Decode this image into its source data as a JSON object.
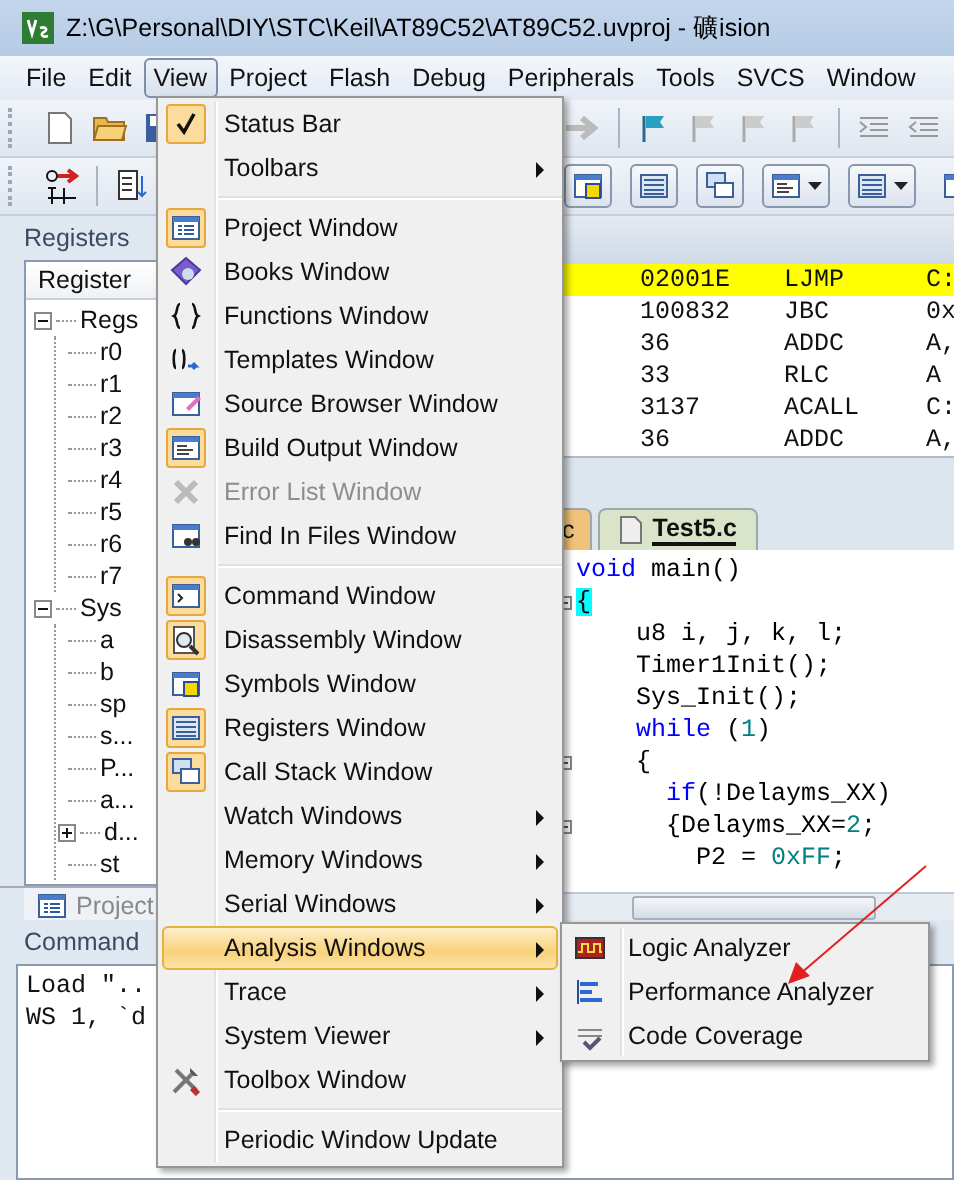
{
  "window": {
    "title": "Z:\\G\\Personal\\DIY\\STC\\Keil\\AT89C52\\AT89C52.uvproj - 礦ision"
  },
  "menu_bar": [
    {
      "label": "File",
      "selected": false
    },
    {
      "label": "Edit",
      "selected": false
    },
    {
      "label": "View",
      "selected": true
    },
    {
      "label": "Project",
      "selected": false
    },
    {
      "label": "Flash",
      "selected": false
    },
    {
      "label": "Debug",
      "selected": false
    },
    {
      "label": "Peripherals",
      "selected": false
    },
    {
      "label": "Tools",
      "selected": false
    },
    {
      "label": "SVCS",
      "selected": false
    },
    {
      "label": "Window",
      "selected": false
    }
  ],
  "registers_panel": {
    "title": "Registers",
    "column": "Register",
    "tab": "Project",
    "tree": [
      {
        "label": "Regs",
        "kind": "group",
        "expanded": true,
        "children": [
          {
            "label": "r0",
            "kind": "leaf"
          },
          {
            "label": "r1",
            "kind": "leaf"
          },
          {
            "label": "r2",
            "kind": "leaf"
          },
          {
            "label": "r3",
            "kind": "leaf"
          },
          {
            "label": "r4",
            "kind": "leaf"
          },
          {
            "label": "r5",
            "kind": "leaf"
          },
          {
            "label": "r6",
            "kind": "leaf"
          },
          {
            "label": "r7",
            "kind": "leaf"
          }
        ]
      },
      {
        "label": "Sys",
        "kind": "group",
        "expanded": true,
        "children": [
          {
            "label": "a",
            "kind": "leaf"
          },
          {
            "label": "b",
            "kind": "leaf"
          },
          {
            "label": "sp",
            "kind": "leaf"
          },
          {
            "label": "s...",
            "kind": "leaf"
          },
          {
            "label": "P...",
            "kind": "leaf"
          },
          {
            "label": "a...",
            "kind": "leaf"
          },
          {
            "label": "d...",
            "kind": "group",
            "expanded": false
          },
          {
            "label": "st",
            "kind": "leaf"
          }
        ]
      }
    ]
  },
  "disassembly": {
    "rows": [
      {
        "opcode": "02001E",
        "mnemonic": "LJMP",
        "operand": "C:",
        "current": true
      },
      {
        "opcode": "100832",
        "mnemonic": "JBC",
        "operand": "0x",
        "current": false
      },
      {
        "opcode": "36",
        "mnemonic": "ADDC",
        "operand": "A,",
        "current": false
      },
      {
        "opcode": "33",
        "mnemonic": "RLC",
        "operand": "A",
        "current": false
      },
      {
        "opcode": "3137",
        "mnemonic": "ACALL",
        "operand": "C:",
        "current": false
      },
      {
        "opcode": "36",
        "mnemonic": "ADDC",
        "operand": "A,",
        "current": false
      }
    ]
  },
  "editor": {
    "tabs": [
      {
        "label": "c",
        "selected": false
      },
      {
        "label": "Test5.c",
        "selected": true
      }
    ],
    "lines": [
      {
        "fold": false,
        "tokens": [
          {
            "text": "void",
            "kind": "keyword"
          },
          {
            "text": " main()",
            "kind": "plain"
          }
        ]
      },
      {
        "fold": true,
        "tokens": [
          {
            "text": "{",
            "kind": "brace_match"
          }
        ]
      },
      {
        "fold": false,
        "tokens": [
          {
            "text": "    u8 i, j, k, l;",
            "kind": "plain"
          }
        ]
      },
      {
        "fold": false,
        "tokens": [
          {
            "text": "    Timer1Init();",
            "kind": "plain"
          }
        ]
      },
      {
        "fold": false,
        "tokens": [
          {
            "text": "    Sys_Init();",
            "kind": "plain"
          }
        ]
      },
      {
        "fold": false,
        "tokens": [
          {
            "text": "    while",
            "kind": "keyword"
          },
          {
            "text": " (",
            "kind": "plain"
          },
          {
            "text": "1",
            "kind": "number"
          },
          {
            "text": ")",
            "kind": "plain"
          }
        ]
      },
      {
        "fold": true,
        "tokens": [
          {
            "text": "    {",
            "kind": "plain"
          }
        ]
      },
      {
        "fold": false,
        "tokens": [
          {
            "text": "      if",
            "kind": "keyword"
          },
          {
            "text": "(!Delayms_XX)",
            "kind": "plain"
          }
        ]
      },
      {
        "fold": true,
        "tokens": [
          {
            "text": "      {Delayms_XX=",
            "kind": "plain"
          },
          {
            "text": "2",
            "kind": "number"
          },
          {
            "text": ";",
            "kind": "plain"
          }
        ]
      },
      {
        "fold": false,
        "tokens": [
          {
            "text": "        P2 = ",
            "kind": "plain"
          },
          {
            "text": "0xFF",
            "kind": "number"
          },
          {
            "text": ";",
            "kind": "plain"
          }
        ]
      }
    ]
  },
  "command_panel": {
    "title": "Command",
    "lines": [
      "Load \"..",
      "WS 1, `d"
    ]
  },
  "view_menu": {
    "items": [
      {
        "kind": "item",
        "label": "Status Bar",
        "checked": true,
        "disabled": false,
        "selected": false,
        "submenu": false
      },
      {
        "kind": "item",
        "label": "Toolbars",
        "checked": false,
        "disabled": false,
        "selected": false,
        "submenu": true
      },
      {
        "kind": "separator"
      },
      {
        "kind": "item",
        "label": "Project Window",
        "checked": true,
        "disabled": false,
        "selected": false,
        "submenu": false
      },
      {
        "kind": "item",
        "label": "Books Window",
        "checked": false,
        "disabled": false,
        "selected": false,
        "submenu": false
      },
      {
        "kind": "item",
        "label": "Functions Window",
        "checked": false,
        "disabled": false,
        "selected": false,
        "submenu": false
      },
      {
        "kind": "item",
        "label": "Templates Window",
        "checked": false,
        "disabled": false,
        "selected": false,
        "submenu": false
      },
      {
        "kind": "item",
        "label": "Source Browser Window",
        "checked": false,
        "disabled": false,
        "selected": false,
        "submenu": false
      },
      {
        "kind": "item",
        "label": "Build Output Window",
        "checked": true,
        "disabled": false,
        "selected": false,
        "submenu": false
      },
      {
        "kind": "item",
        "label": "Error List Window",
        "checked": false,
        "disabled": true,
        "selected": false,
        "submenu": false
      },
      {
        "kind": "item",
        "label": "Find In Files Window",
        "checked": false,
        "disabled": false,
        "selected": false,
        "submenu": false
      },
      {
        "kind": "separator"
      },
      {
        "kind": "item",
        "label": "Command Window",
        "checked": true,
        "disabled": false,
        "selected": false,
        "submenu": false
      },
      {
        "kind": "item",
        "label": "Disassembly Window",
        "checked": true,
        "disabled": false,
        "selected": false,
        "submenu": false
      },
      {
        "kind": "item",
        "label": "Symbols Window",
        "checked": false,
        "disabled": false,
        "selected": false,
        "submenu": false
      },
      {
        "kind": "item",
        "label": "Registers Window",
        "checked": true,
        "disabled": false,
        "selected": false,
        "submenu": false
      },
      {
        "kind": "item",
        "label": "Call Stack Window",
        "checked": true,
        "disabled": false,
        "selected": false,
        "submenu": false
      },
      {
        "kind": "item",
        "label": "Watch Windows",
        "checked": false,
        "disabled": false,
        "selected": false,
        "submenu": true
      },
      {
        "kind": "item",
        "label": "Memory Windows",
        "checked": false,
        "disabled": false,
        "selected": false,
        "submenu": true
      },
      {
        "kind": "item",
        "label": "Serial Windows",
        "checked": false,
        "disabled": false,
        "selected": false,
        "submenu": true
      },
      {
        "kind": "item",
        "label": "Analysis Windows",
        "checked": false,
        "disabled": false,
        "selected": true,
        "submenu": true
      },
      {
        "kind": "item",
        "label": "Trace",
        "checked": false,
        "disabled": false,
        "selected": false,
        "submenu": true
      },
      {
        "kind": "item",
        "label": "System Viewer",
        "checked": false,
        "disabled": false,
        "selected": false,
        "submenu": true
      },
      {
        "kind": "item",
        "label": "Toolbox Window",
        "checked": false,
        "disabled": false,
        "selected": false,
        "submenu": false
      },
      {
        "kind": "separator"
      },
      {
        "kind": "item",
        "label": "Periodic Window Update",
        "checked": false,
        "disabled": false,
        "selected": false,
        "submenu": false
      }
    ]
  },
  "analysis_submenu": {
    "items": [
      {
        "label": "Logic Analyzer"
      },
      {
        "label": "Performance Analyzer"
      },
      {
        "label": "Code Coverage"
      }
    ]
  }
}
